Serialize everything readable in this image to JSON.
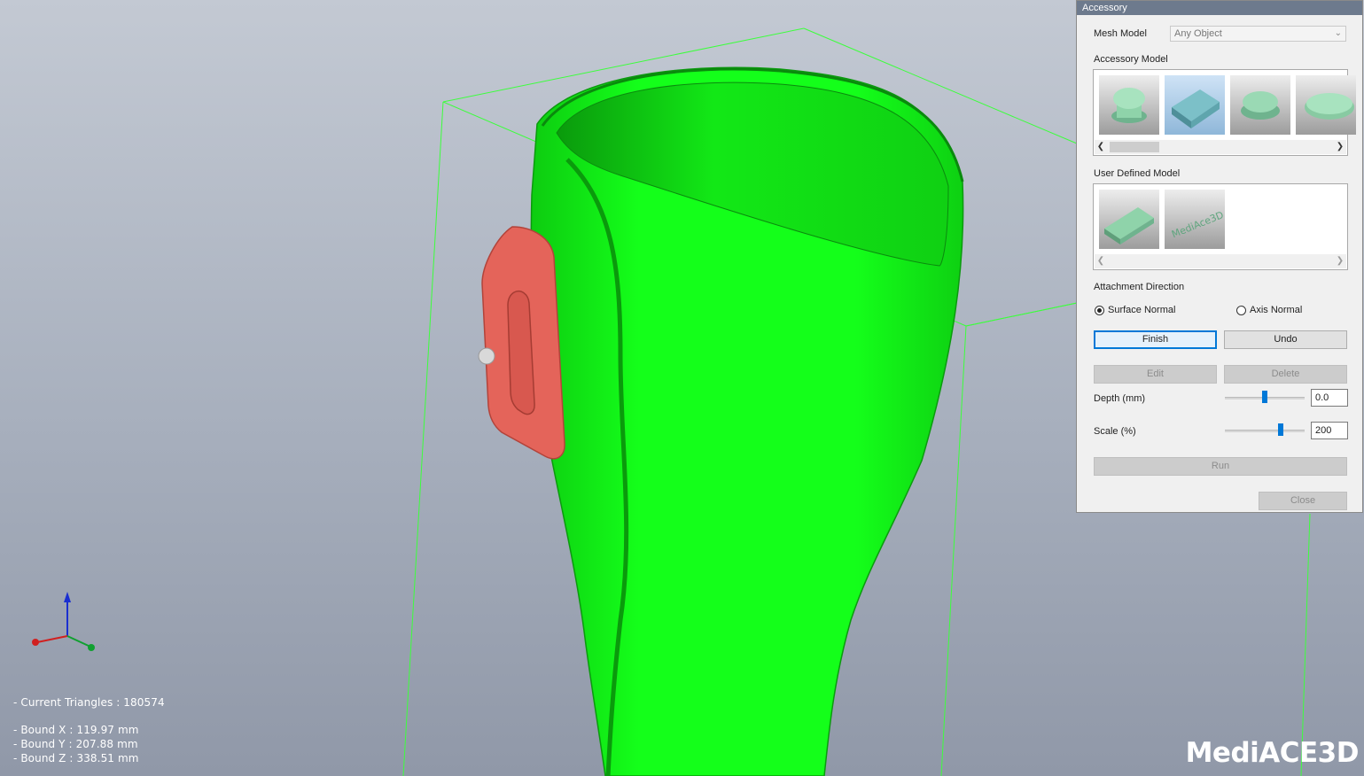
{
  "stats": {
    "triangles": "- Current Triangles : 180574",
    "bound_x": "- Bound X : 119.97 mm",
    "bound_y": "- Bound Y : 207.88 mm",
    "bound_z": "- Bound Z : 338.51 mm"
  },
  "logo": "MediACE3D",
  "colors": {
    "mesh": "#12ff18",
    "accessory": "#e4645a",
    "bbox": "#3cff3c",
    "titlebar": "#6d7a8d",
    "accent": "#0078d7"
  },
  "axes_icons": [
    "x-axis-red",
    "y-axis-green",
    "z-axis-blue"
  ],
  "dialog": {
    "title": "Accessory",
    "mesh_model_label": "Mesh Model",
    "mesh_model_value": "Any Object",
    "accessory_model_label": "Accessory Model",
    "accessory_thumbs": [
      "round-cap-icon",
      "bar-block-icon",
      "dome-button-icon",
      "oval-button-icon"
    ],
    "accessory_selected_index": 1,
    "user_defined_label": "User Defined Model",
    "user_thumbs": [
      "flat-block-icon",
      "embossed-text-icon"
    ],
    "attachment_label": "Attachment Direction",
    "surface_normal": "Surface Normal",
    "axis_normal": "Axis Normal",
    "surface_normal_checked": true,
    "finish": "Finish",
    "undo": "Undo",
    "edit": "Edit",
    "delete": "Delete",
    "depth_label": "Depth (mm)",
    "depth_value": "0.0",
    "depth_slider": 0.5,
    "scale_label": "Scale (%)",
    "scale_value": "200",
    "scale_slider": 0.72,
    "run": "Run",
    "close": "Close"
  }
}
